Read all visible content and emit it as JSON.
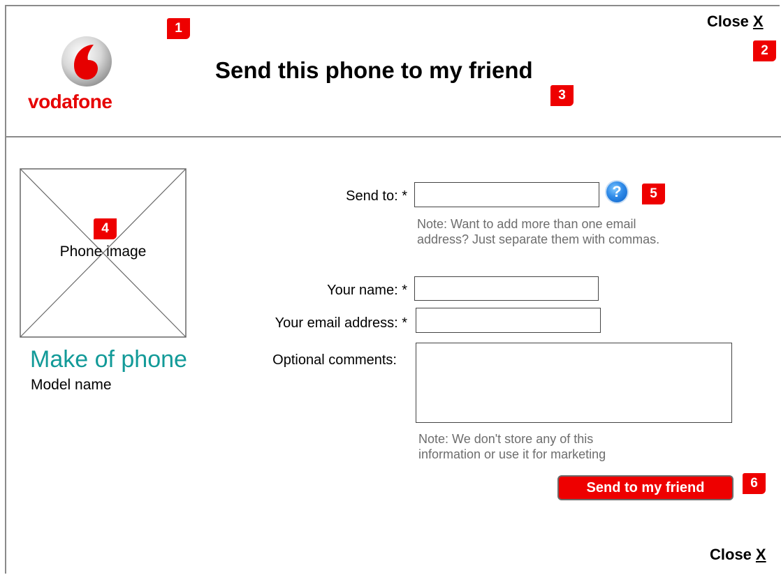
{
  "header": {
    "logo_text": "vodafone",
    "title": "Send this phone to my friend",
    "close_label": "Close",
    "close_x": "X"
  },
  "footer": {
    "close_label": "Close",
    "close_x": "X"
  },
  "phone": {
    "image_label": "Phone image",
    "make": "Make of phone",
    "model": "Model name"
  },
  "form": {
    "send_to_label": "Send to: *",
    "send_to_value": "",
    "help_icon": "?",
    "send_to_note": "Note: Want to add more than one email address? Just separate them with commas.",
    "your_name_label": "Your name: *",
    "your_name_value": "",
    "your_email_label": "Your email address: *",
    "your_email_value": "",
    "comments_label": "Optional comments:",
    "comments_value": "",
    "privacy_note": "Note: We don't store any of this information or use it for marketing",
    "submit_label": "Send to my friend"
  },
  "annotations": [
    "1",
    "2",
    "3",
    "4",
    "5",
    "6"
  ],
  "icons": {
    "logo": "vodafone-logo-icon",
    "help": "help-icon",
    "image_placeholder": "image-placeholder-icon"
  },
  "colors": {
    "brand_red": "#ee0000",
    "make_teal": "#129a98",
    "note_gray": "#6d6d6d",
    "help_blue": "#2f8ae8"
  }
}
